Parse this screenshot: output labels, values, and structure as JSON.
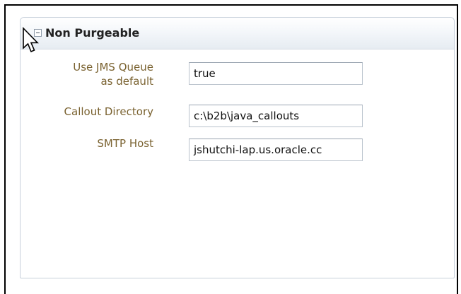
{
  "panel": {
    "title": "Non Purgeable",
    "toggle_icon": "collapse-minus-icon"
  },
  "fields": {
    "use_jms_queue": {
      "label_line1": "Use JMS Queue",
      "label_line2": "as default",
      "value": "true"
    },
    "callout_directory": {
      "label": "Callout Directory",
      "value": "c:\\b2b\\java_callouts"
    },
    "smtp_host": {
      "label": "SMTP Host",
      "value": "jshutchi-lap.us.oracle.cc"
    }
  },
  "colors": {
    "label_text": "#7a6230",
    "header_gradient_end": "#e6ecf2",
    "panel_border": "#c7d0db"
  },
  "cursor": "mouse-pointer-icon"
}
